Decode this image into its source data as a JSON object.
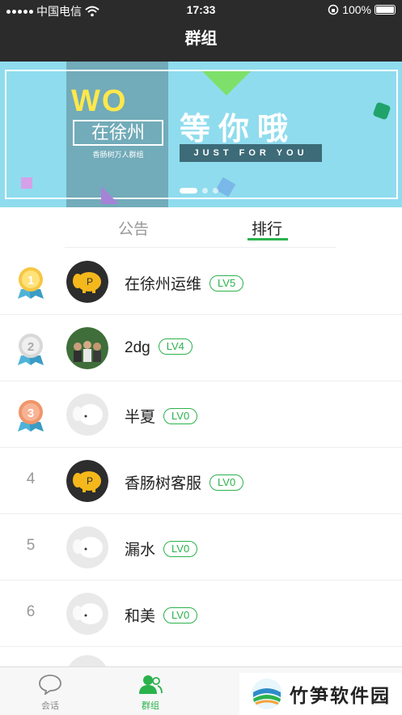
{
  "status": {
    "carrier": "中国电信",
    "time": "17:33",
    "battery": "100%"
  },
  "nav": {
    "title": "群组"
  },
  "banner": {
    "wo": "WO",
    "city": "在徐州",
    "sub": "香肠树万人群组",
    "big": "等你哦",
    "tagline": "JUST FOR YOU",
    "page_count": 3,
    "active_page": 1
  },
  "tabs": {
    "announcement": "公告",
    "ranking": "排行",
    "active": "ranking"
  },
  "ranking": [
    {
      "rank": "1",
      "name": "在徐州运维",
      "level": "LV5",
      "avatar": "elephant-dark"
    },
    {
      "rank": "2",
      "name": "2dg",
      "level": "LV4",
      "avatar": "group-photo"
    },
    {
      "rank": "3",
      "name": "半夏",
      "level": "LV0",
      "avatar": "elephant-light"
    },
    {
      "rank": "4",
      "name": "香肠树客服",
      "level": "LV0",
      "avatar": "elephant-dark"
    },
    {
      "rank": "5",
      "name": "漏水",
      "level": "LV0",
      "avatar": "elephant-light"
    },
    {
      "rank": "6",
      "name": "和美",
      "level": "LV0",
      "avatar": "elephant-light"
    }
  ],
  "bottom_tabs": [
    {
      "label": "会话",
      "icon": "chat-bubble-icon",
      "active": false
    },
    {
      "label": "群组",
      "icon": "group-icon",
      "active": true
    }
  ],
  "watermark": {
    "text": "竹笋软件园"
  },
  "colors": {
    "accent": "#2bb24c",
    "bar": "#2b2b2b"
  }
}
